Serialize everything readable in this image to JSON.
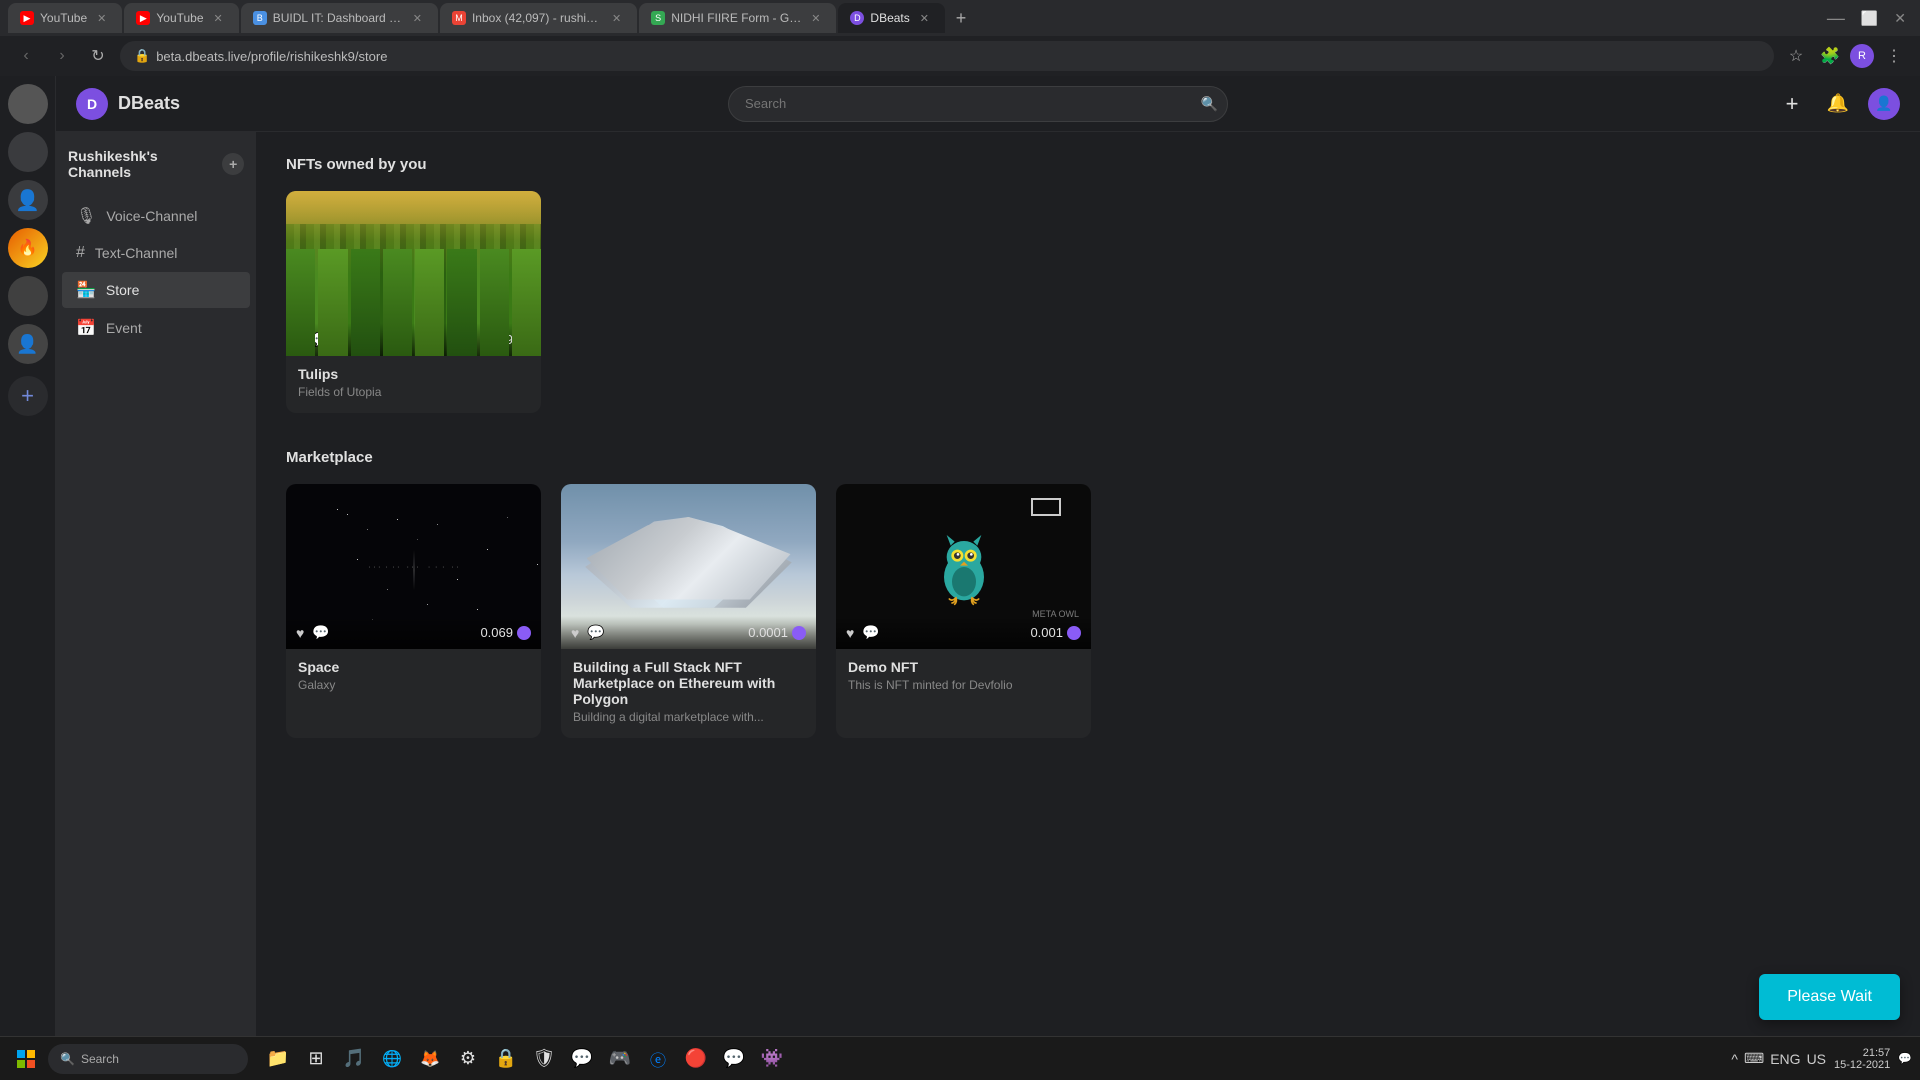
{
  "browser": {
    "tabs": [
      {
        "label": "YouTube",
        "favicon": "▶",
        "active": false,
        "id": "yt1"
      },
      {
        "label": "YouTube",
        "favicon": "▶",
        "active": false,
        "id": "yt2"
      },
      {
        "label": "BUIDL IT: Dashboard | Devfolio",
        "favicon": "🔨",
        "active": false,
        "id": "buidl"
      },
      {
        "label": "Inbox (42,097) - rushikeshkardi...",
        "favicon": "✉",
        "active": false,
        "id": "gmail"
      },
      {
        "label": "NIDHI FIIRE Form - Google Shee...",
        "favicon": "📊",
        "active": false,
        "id": "gsheets"
      },
      {
        "label": "DBeats",
        "favicon": "🎵",
        "active": true,
        "id": "dbeats"
      }
    ],
    "url": "beta.dbeats.live/profile/rishikeshk9/store"
  },
  "app": {
    "name": "DBeats",
    "logo_letter": "D"
  },
  "topnav": {
    "search_placeholder": "Search",
    "add_label": "+",
    "notification_icon": "🔔",
    "user_icon": "👤"
  },
  "rail": {
    "avatars": [
      {
        "id": "av1",
        "label": "",
        "color": "gray"
      },
      {
        "id": "av2",
        "label": "",
        "color": "gray"
      },
      {
        "id": "av3",
        "label": "👤",
        "color": "face1"
      },
      {
        "id": "av4",
        "label": "🔥",
        "color": "orange"
      },
      {
        "id": "av5",
        "label": "",
        "color": "gray"
      },
      {
        "id": "av6",
        "label": "👤",
        "color": "face2"
      }
    ],
    "add_label": "+"
  },
  "sidebar": {
    "channel_header": "Rushikeshk's Channels",
    "add_icon": "+",
    "items": [
      {
        "id": "voice",
        "icon": "🎙",
        "label": "Voice-Channel"
      },
      {
        "id": "text",
        "icon": "#",
        "label": "Text-Channel"
      },
      {
        "id": "store",
        "icon": "🏪",
        "label": "Store",
        "active": true
      },
      {
        "id": "event",
        "icon": "📅",
        "label": "Event"
      }
    ]
  },
  "nfts_owned": {
    "section_title": "NFTs owned by you",
    "items": [
      {
        "id": "tulips",
        "type": "tulips",
        "title": "Tulips",
        "subtitle": "Fields of Utopia",
        "price": "0.069",
        "liked": false
      }
    ]
  },
  "marketplace": {
    "section_title": "Marketplace",
    "items": [
      {
        "id": "space",
        "type": "space",
        "title": "Space",
        "subtitle": "Galaxy",
        "price": "0.069",
        "liked": false
      },
      {
        "id": "nft-course",
        "type": "mountain",
        "title": "Building a Full Stack NFT Marketplace on Ethereum with Polygon",
        "subtitle": "Building a digital marketplace with...",
        "price": "0.0001",
        "liked": false
      },
      {
        "id": "demo-nft",
        "type": "owl",
        "title": "Demo NFT",
        "subtitle": "This is NFT minted for Devfolio",
        "price": "0.001",
        "liked": false
      }
    ]
  },
  "toast": {
    "label": "Please Wait"
  },
  "taskbar": {
    "search_placeholder": "Search",
    "time": "21:57",
    "date": "15-12-2021",
    "lang": "ENG",
    "region": "US",
    "apps": [
      "🪟",
      "🔍",
      "📁",
      "⊞",
      "🎵",
      "🌐",
      "🦊",
      "🔧",
      "🔒",
      "🛡",
      "💬",
      "🎮"
    ]
  }
}
